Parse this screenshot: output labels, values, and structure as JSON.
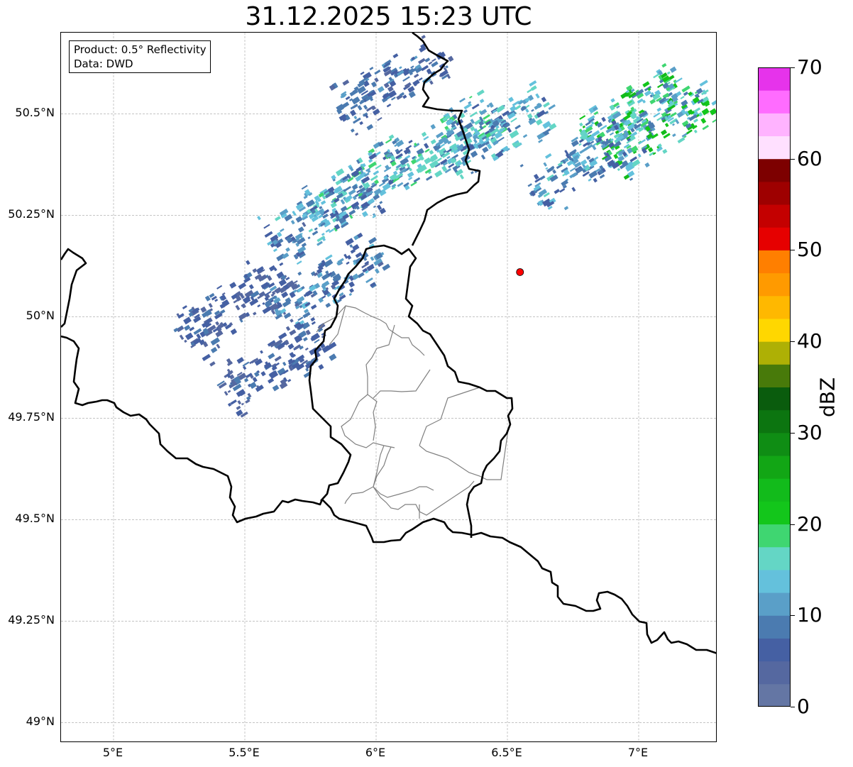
{
  "title": "31.12.2025 15:23 UTC",
  "info": {
    "product": "Product: 0.5° Reflectivity",
    "data": "Data: DWD"
  },
  "map": {
    "lon_range": [
      4.8,
      7.3
    ],
    "lat_range": [
      48.95,
      50.7
    ],
    "lat_ticks": [
      {
        "value": 50.5,
        "label": "50.5°N"
      },
      {
        "value": 50.25,
        "label": "50.25°N"
      },
      {
        "value": 50.0,
        "label": "50°N"
      },
      {
        "value": 49.75,
        "label": "49.75°N"
      },
      {
        "value": 49.5,
        "label": "49.5°N"
      },
      {
        "value": 49.25,
        "label": "49.25°N"
      },
      {
        "value": 49.0,
        "label": "49°N"
      }
    ],
    "lon_ticks": [
      {
        "value": 5.0,
        "label": "5°E"
      },
      {
        "value": 5.5,
        "label": "5.5°E"
      },
      {
        "value": 6.0,
        "label": "6°E"
      },
      {
        "value": 6.5,
        "label": "6.5°E"
      },
      {
        "value": 7.0,
        "label": "7°E"
      }
    ],
    "radar_site": {
      "lon": 6.548,
      "lat": 50.11,
      "color": "#ff0000"
    },
    "gridlines": true
  },
  "colorbar": {
    "label": "dBZ",
    "min": 0,
    "max": 70,
    "ticks": [
      {
        "value": 0,
        "label": "0"
      },
      {
        "value": 10,
        "label": "10"
      },
      {
        "value": 20,
        "label": "20"
      },
      {
        "value": 30,
        "label": "30"
      },
      {
        "value": 40,
        "label": "40"
      },
      {
        "value": 50,
        "label": "50"
      },
      {
        "value": 60,
        "label": "60"
      },
      {
        "value": 70,
        "label": "70"
      }
    ],
    "colors": [
      "#6476a4",
      "#5568a0",
      "#4560a3",
      "#4b7bb0",
      "#5a9fc8",
      "#64c1dc",
      "#64d6c5",
      "#3fd671",
      "#13c61b",
      "#12bb1b",
      "#12a615",
      "#0f8d14",
      "#0c7510",
      "#0a5c0d",
      "#487a0a",
      "#aeb005",
      "#ffd700",
      "#ffb800",
      "#ff9a00",
      "#ff7f00",
      "#e60000",
      "#c40000",
      "#9e0000",
      "#7d0000",
      "#ffe0ff",
      "#ffb3ff",
      "#ff6cff",
      "#e633eb"
    ]
  },
  "chart_data": {
    "type": "heatmap",
    "title": "31.12.2025 15:23 UTC",
    "xlabel": "",
    "ylabel": "",
    "xlim": [
      4.8,
      7.3
    ],
    "ylim": [
      48.95,
      50.7
    ],
    "colorbar_label": "dBZ",
    "colorbar_range": [
      0,
      70
    ],
    "echo_clusters": [
      {
        "lon": 5.93,
        "lat": 50.33,
        "dbz": 18
      },
      {
        "lon": 5.78,
        "lat": 50.25,
        "dbz": 14
      },
      {
        "lon": 5.8,
        "lat": 50.08,
        "dbz": 12
      },
      {
        "lon": 6.25,
        "lat": 50.43,
        "dbz": 18
      },
      {
        "lon": 6.05,
        "lat": 50.58,
        "dbz": 10
      },
      {
        "lon": 6.45,
        "lat": 50.45,
        "dbz": 16
      },
      {
        "lon": 6.95,
        "lat": 50.5,
        "dbz": 22
      },
      {
        "lon": 7.08,
        "lat": 50.47,
        "dbz": 22
      },
      {
        "lon": 6.78,
        "lat": 50.38,
        "dbz": 14
      },
      {
        "lon": 5.45,
        "lat": 50.03,
        "dbz": 8
      },
      {
        "lon": 5.6,
        "lat": 49.88,
        "dbz": 8
      }
    ]
  }
}
